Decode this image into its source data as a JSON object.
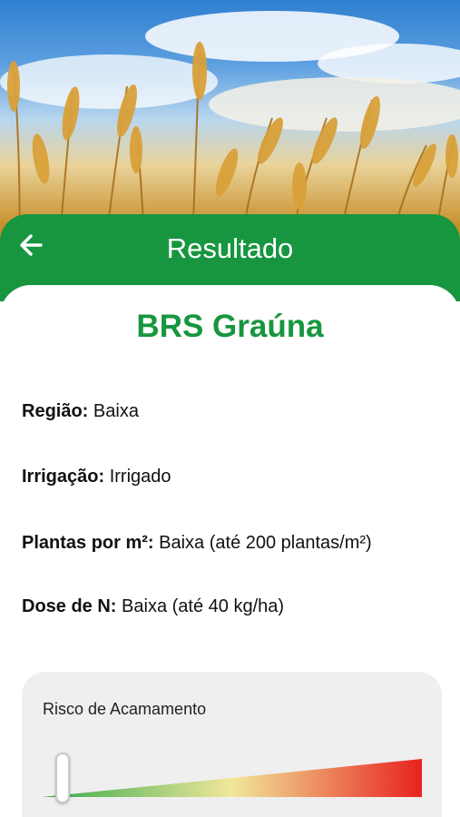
{
  "header": {
    "title": "Resultado",
    "back_icon": "arrow-left-icon",
    "color": "#17963f"
  },
  "result": {
    "variety": "BRS Graúna",
    "fields": [
      {
        "label": "Região:",
        "value": "Baixa"
      },
      {
        "label": "Irrigação:",
        "value": "Irrigado"
      },
      {
        "label": "Plantas por m²:",
        "value": "Baixa (até 200 plantas/m²)"
      },
      {
        "label": "Dose de N:",
        "value": "Baixa (até 40 kg/ha)"
      }
    ]
  },
  "risk": {
    "label": "Risco de Acamamento",
    "level": 0.0,
    "gradient": [
      "#33a84a",
      "#f1e79a",
      "#e8221e"
    ]
  }
}
